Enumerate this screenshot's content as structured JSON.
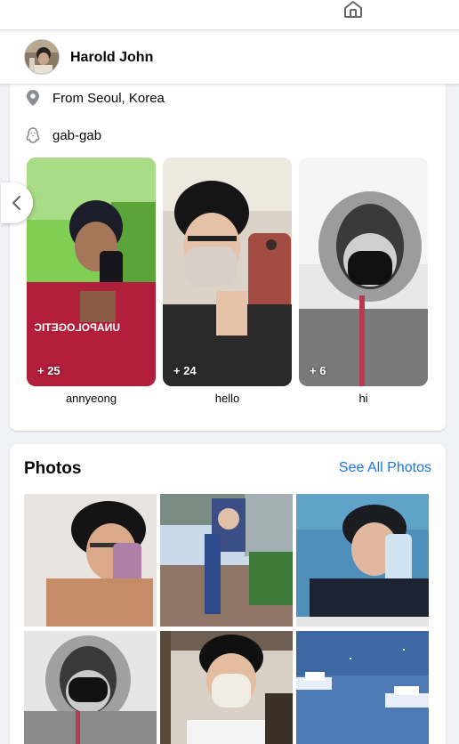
{
  "nav": {
    "home_icon": "home-icon"
  },
  "profile": {
    "name": "Harold John"
  },
  "intro": {
    "location_prefix": "From ",
    "location_place": "Seoul, Korea",
    "handle": "gab-gab"
  },
  "highlights": [
    {
      "label": "annyeong",
      "count": "+ 25"
    },
    {
      "label": "hello",
      "count": "+ 24"
    },
    {
      "label": "hi",
      "count": "+ 6"
    }
  ],
  "photos": {
    "title": "Photos",
    "see_all": "See All Photos"
  },
  "colors": {
    "link": "#1877f2",
    "icon": "#65676b"
  }
}
